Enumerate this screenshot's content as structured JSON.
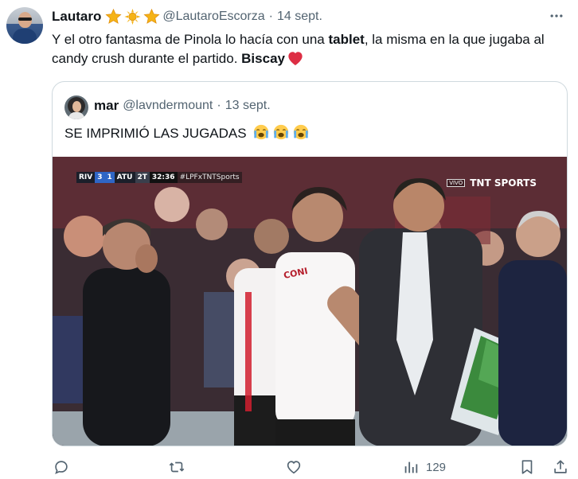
{
  "tweet": {
    "display_name": "Lautaro",
    "handle": "@LautaroEscorza",
    "separator": "·",
    "timestamp": "14 sept.",
    "badges": [
      "star-icon",
      "sun-icon",
      "star-icon"
    ],
    "text_part1": "Y el otro fantasma de Pinola lo hacía con una ",
    "text_bold1": "tablet",
    "text_part2": ", la misma en la que jugaba al candy crush durante el partido. ",
    "text_bold2": "Biscay",
    "text_emoji": "red-heart-icon"
  },
  "quote": {
    "display_name": "mar",
    "handle": "@lavndermount",
    "separator": "·",
    "timestamp": "13 sept.",
    "text": "SE IMPRIMIÓ LAS JUGADAS",
    "emojis": [
      "loudly-crying-face-icon",
      "loudly-crying-face-icon",
      "loudly-crying-face-icon"
    ]
  },
  "media": {
    "scorebug": {
      "home_team": "RIV",
      "home_score": "3",
      "away_score": "1",
      "away_team": "ATU",
      "half": "2T",
      "clock": "32:36",
      "hashtag": "#LPFxTNTSports"
    },
    "channel": {
      "live_tag": "VIVO",
      "name": "TNT SPORTS"
    },
    "shirt_text": "CONI"
  },
  "actions": {
    "views": "129",
    "icons": [
      "reply-icon",
      "retweet-icon",
      "like-icon",
      "views-icon",
      "bookmark-icon",
      "share-icon"
    ]
  },
  "colors": {
    "text_primary": "#0f1419",
    "text_secondary": "#536471",
    "border": "#cfd9de",
    "heart": "#e0245e"
  }
}
